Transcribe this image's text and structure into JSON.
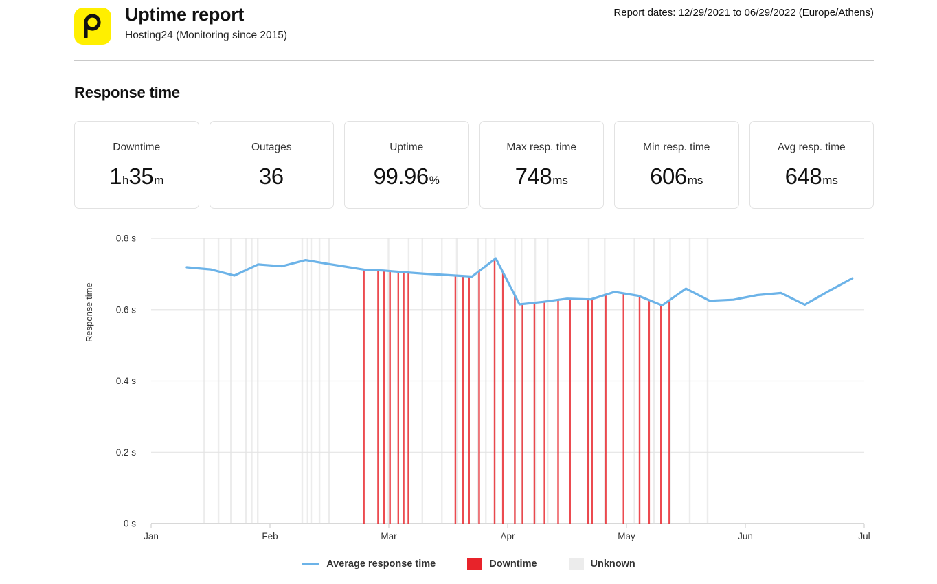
{
  "header": {
    "logo_icon": "pingdom-p-logo",
    "logo_bg": "#ffef00",
    "title": "Uptime report",
    "subtitle": "Hosting24 (Monitoring since 2015)",
    "report_dates": "Report dates: 12/29/2021 to 06/29/2022 (Europe/Athens)"
  },
  "section": {
    "title": "Response time"
  },
  "cards": [
    {
      "label": "Downtime",
      "value": "1",
      "unit": "h",
      "value2": "35",
      "unit2": "m"
    },
    {
      "label": "Outages",
      "value": "36",
      "unit": ""
    },
    {
      "label": "Uptime",
      "value": "99.96",
      "unit": "%"
    },
    {
      "label": "Max resp. time",
      "value": "748",
      "unit": "ms"
    },
    {
      "label": "Min resp. time",
      "value": "606",
      "unit": "ms"
    },
    {
      "label": "Avg resp. time",
      "value": "648",
      "unit": "ms"
    }
  ],
  "legend": [
    {
      "label": "Average response time",
      "type": "line",
      "color": "#6cb3e8"
    },
    {
      "label": "Downtime",
      "type": "box",
      "color": "#e8232a"
    },
    {
      "label": "Unknown",
      "type": "box",
      "color": "#ececec"
    }
  ],
  "chart_data": {
    "type": "line",
    "title": "Response time",
    "xlabel": "",
    "ylabel": "Response time",
    "ylim": [
      0,
      0.8
    ],
    "ytick_labels": [
      "0.8 s",
      "0.6 s",
      "0.4 s",
      "0.2 s",
      "0 s"
    ],
    "ytick_values": [
      0.8,
      0.6,
      0.4,
      0.2,
      0
    ],
    "xtick_labels": [
      "Jan",
      "Feb",
      "Mar",
      "Apr",
      "May",
      "Jun",
      "Jul"
    ],
    "grid": true,
    "legend_position": "bottom",
    "series": [
      {
        "name": "Average response time",
        "color": "#6cb3e8",
        "x": [
          0.06,
          0.1,
          0.14,
          0.18,
          0.22,
          0.26,
          0.3,
          0.33,
          0.36,
          0.39,
          0.42,
          0.46,
          0.5,
          0.54,
          0.58,
          0.62,
          0.66,
          0.7,
          0.74,
          0.78,
          0.82,
          0.86,
          0.9,
          0.94,
          0.98,
          1.02,
          1.06,
          1.1,
          1.14,
          1.18
        ],
        "values": [
          0.719,
          0.713,
          0.696,
          0.727,
          0.722,
          0.739,
          0.728,
          0.72,
          0.712,
          0.71,
          0.706,
          0.701,
          0.697,
          0.693,
          0.744,
          0.615,
          0.622,
          0.631,
          0.629,
          0.65,
          0.639,
          0.612,
          0.659,
          0.625,
          0.628,
          0.641,
          0.647,
          0.614,
          0.652,
          0.688
        ]
      }
    ],
    "downtime_color": "#e8232a",
    "unknown_color": "#ececec",
    "downtime_count": 36,
    "unknown_bands": [
      0.088,
      0.112,
      0.133,
      0.158,
      0.168,
      0.178,
      0.253,
      0.262,
      0.268,
      0.282,
      0.298,
      0.398,
      0.432,
      0.455,
      0.488,
      0.513,
      0.549,
      0.562,
      0.577,
      0.611,
      0.622,
      0.645,
      0.666,
      0.735,
      0.762,
      0.812,
      0.845,
      0.872,
      0.905,
      0.935
    ],
    "downtime_bars": [
      0.358,
      0.382,
      0.392,
      0.402,
      0.416,
      0.425,
      0.433,
      0.512,
      0.525,
      0.535,
      0.552,
      0.578,
      0.592,
      0.612,
      0.625,
      0.645,
      0.662,
      0.685,
      0.705,
      0.735,
      0.742,
      0.765,
      0.795,
      0.822,
      0.838,
      0.858,
      0.872
    ]
  }
}
